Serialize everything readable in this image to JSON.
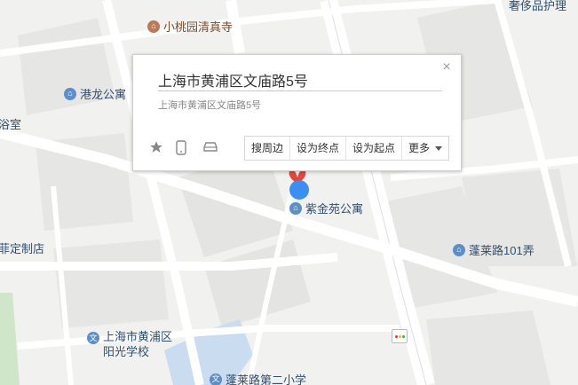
{
  "map": {
    "pois": [
      {
        "name": "小桃园清真寺",
        "icon": "mosque-icon"
      },
      {
        "name": "港龙公寓",
        "icon": "building-icon"
      },
      {
        "name": "紫金苑公寓",
        "icon": "building-icon"
      },
      {
        "name": "蓬莱路101弄",
        "icon": "building-icon"
      },
      {
        "name_line1": "上海市黄浦区",
        "name_line2": "阳光学校",
        "icon": "school-icon"
      },
      {
        "name": "蓬莱路第二小学",
        "icon": "school-icon"
      }
    ],
    "edge_labels": {
      "top_right": "奢侈品护理",
      "left_mid": "浴室",
      "left_lower": "菲定制店"
    },
    "colors": {
      "background": "#f1f1ef",
      "road": "#ffffff",
      "block": "#e3e3e1",
      "water": "#c9dcf0",
      "marker_blue": "#3b8ff0",
      "marker_red": "#e8443a"
    }
  },
  "info_window": {
    "title": "上海市黄浦区文庙路5号",
    "address": "上海市黄浦区文庙路5号",
    "icons": [
      "star-icon",
      "phone-icon",
      "car-icon"
    ],
    "actions": [
      "搜周边",
      "设为终点",
      "设为起点",
      "更多"
    ],
    "close_icon": "close-icon"
  }
}
